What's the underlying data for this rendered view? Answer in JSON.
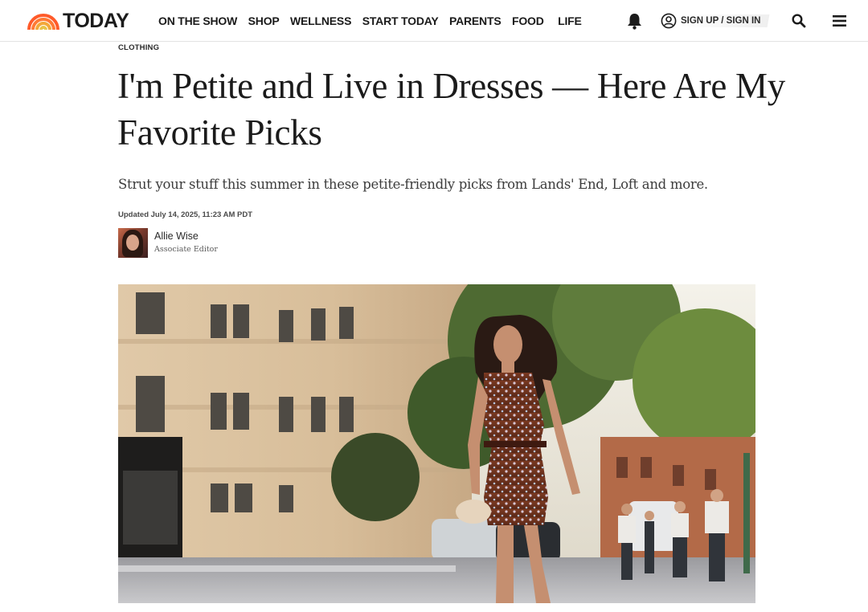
{
  "brand": {
    "name": "TODAY",
    "colors": {
      "rainbow": [
        "#ff5b2a",
        "#ff8a3d",
        "#f3a83a",
        "#e8c34a"
      ]
    }
  },
  "header": {
    "nav": [
      "ON THE SHOW",
      "SHOP",
      "WELLNESS",
      "START TODAY",
      "PARENTS",
      "FOOD",
      "LIFE"
    ],
    "signin_label": "SIGN UP / SIGN IN",
    "icons": [
      "bell-icon",
      "user-icon",
      "search-icon",
      "menu-icon"
    ]
  },
  "article": {
    "category": "CLOTHING",
    "headline": "I'm Petite and Live in Dresses — Here Are My Favorite Picks",
    "dek": "Strut your stuff this summer in these petite-friendly picks from Lands' End, Loft and more.",
    "updated": "Updated July 14, 2025, 11:23 AM PDT",
    "author": {
      "name": "Allie Wise",
      "title": "Associate Editor"
    }
  }
}
